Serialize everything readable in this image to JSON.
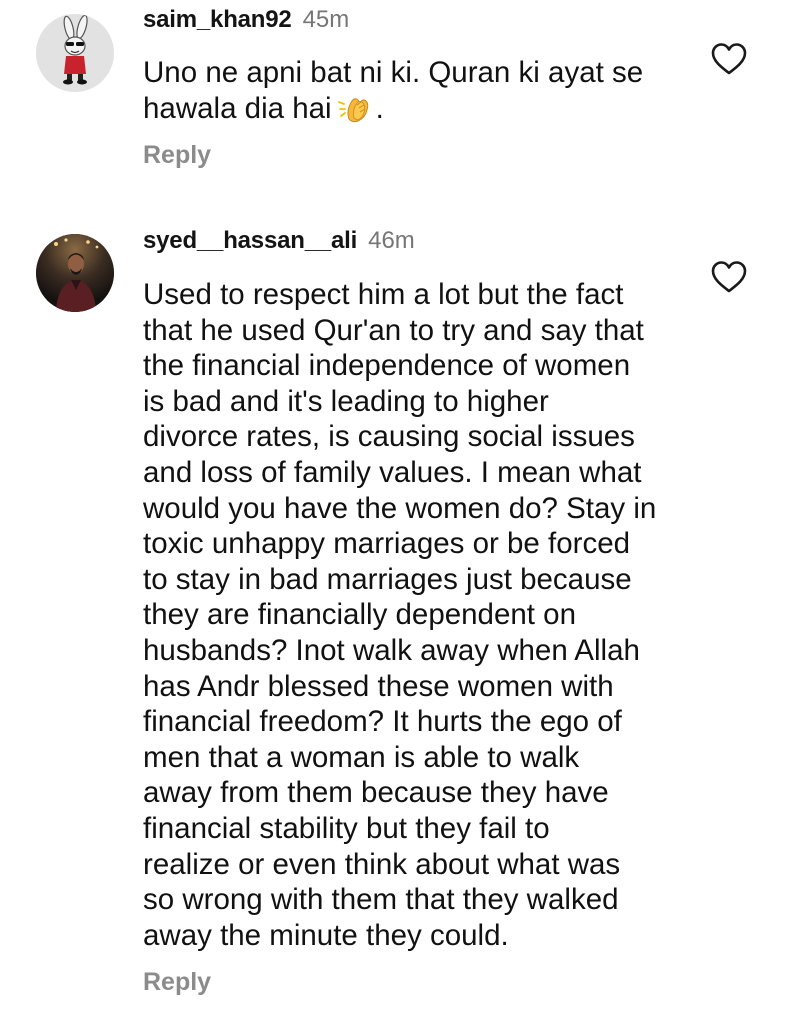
{
  "comments": [
    {
      "username": "saim_khan92",
      "time": "45m",
      "lines": [
        "Uno ne apni bat ni ki. Quran ki ayat se",
        "hawala dia hai",
        "."
      ],
      "emoji": "clapping-hands",
      "reply_label": "Reply",
      "like_icon": "heart-outline-icon"
    },
    {
      "username": "syed__hassan__ali",
      "time": "46m",
      "lines": [
        "Used to respect him a lot but the fact",
        "that he used Qur'an to try and say that",
        "the financial independence of women",
        "is bad and it's leading to higher",
        "divorce rates, is causing social issues",
        "and loss of family values. I mean what",
        "would you have the women do? Stay in",
        "toxic unhappy marriages or be forced",
        "to stay in bad marriages just because",
        "they are financially dependent on",
        "husbands? Inot walk away when Allah",
        "has Andr blessed these women with",
        "financial freedom? It hurts the ego of",
        "men that a woman is able to walk",
        "away from them because they have",
        "financial stability but they fail to",
        "realize or even think about what was",
        "so wrong with them that they walked",
        "away the minute they could."
      ],
      "reply_label": "Reply",
      "like_icon": "heart-outline-icon"
    }
  ],
  "colors": {
    "text": "#111111",
    "username": "#141414",
    "timestamp": "#767676",
    "reply": "#8b8b8b",
    "icon": "#1a1a1a"
  }
}
